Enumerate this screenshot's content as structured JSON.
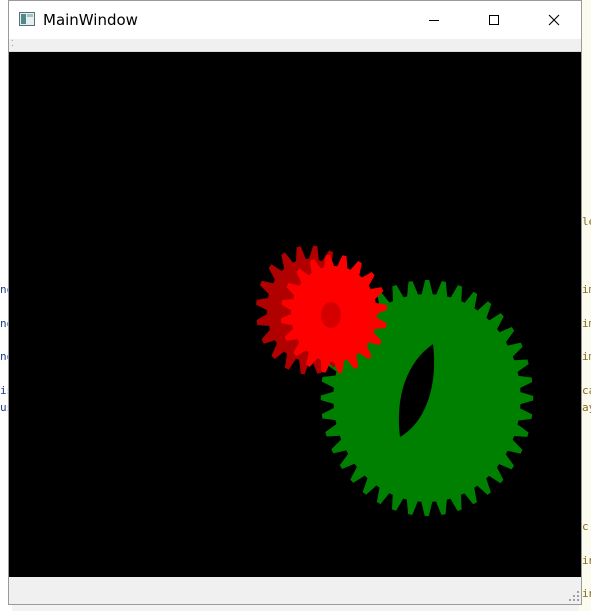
{
  "window": {
    "title": "MainWindow",
    "controls": {
      "minimize_icon": "minimize-icon",
      "maximize_icon": "maximize-icon",
      "close_icon": "close-icon"
    }
  },
  "scene": {
    "background": "#000000",
    "gears": [
      {
        "name": "small-gear",
        "color": "#ff0000",
        "shade_color": "#b00000",
        "teeth": 20
      },
      {
        "name": "large-gear",
        "color": "#008000",
        "teeth": 40
      }
    ]
  },
  "background_strip": {
    "left_marks": [
      "",
      "no",
      "no",
      "no",
      "is",
      "us"
    ],
    "right_marks": [
      "le",
      "im",
      "im",
      "im",
      "ca",
      "ay",
      "c",
      "in",
      "in"
    ]
  }
}
